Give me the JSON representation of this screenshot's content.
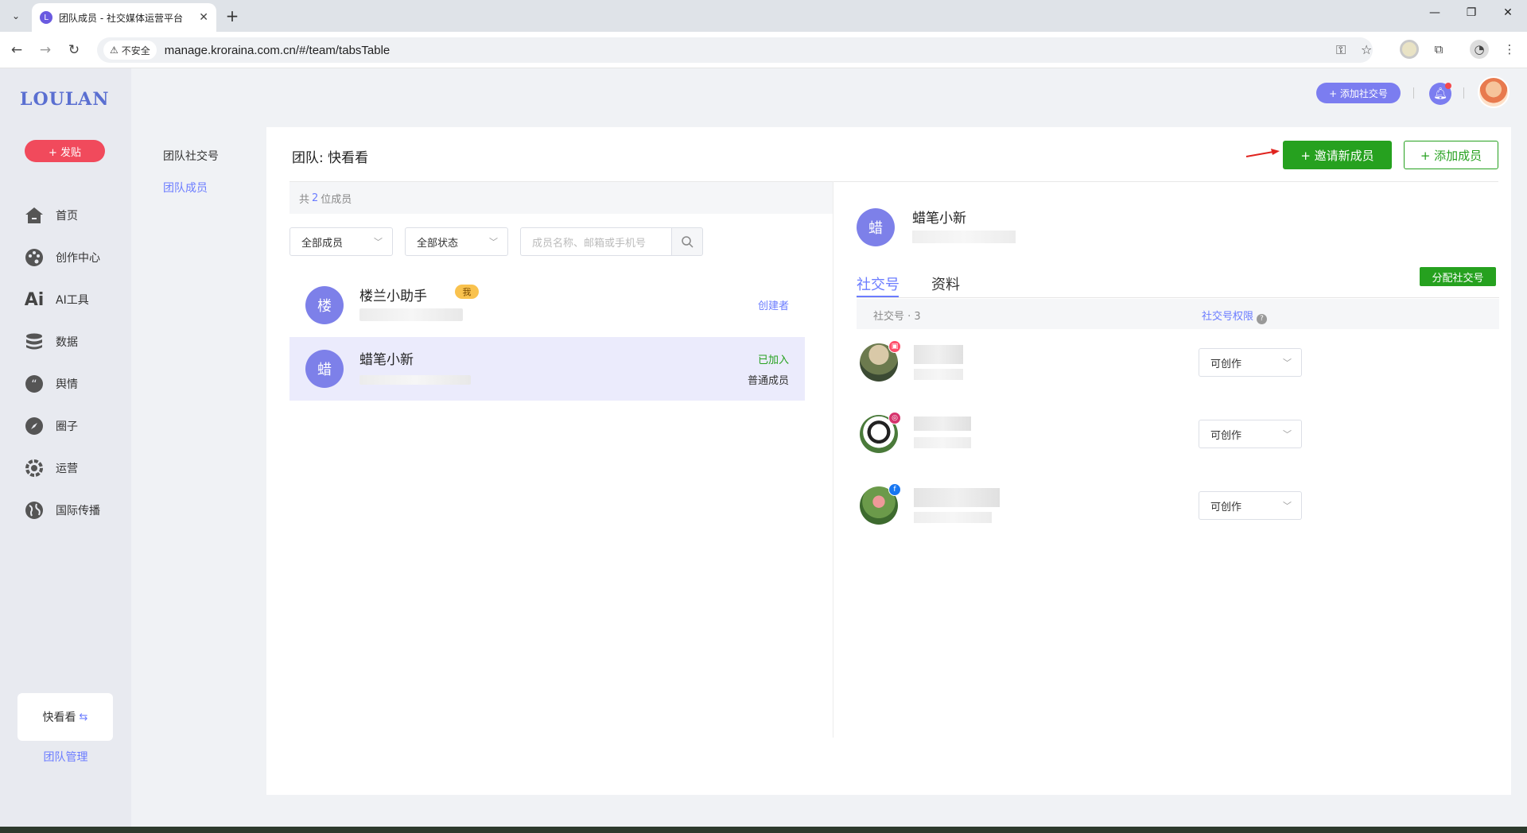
{
  "browser": {
    "tab_title": "团队成员 - 社交媒体运营平台",
    "security_label": "不安全",
    "url": "manage.kroraina.com.cn/#/team/tabsTable"
  },
  "sidebar": {
    "logo": "LOULAN",
    "post_button": "+ 发贴",
    "items": [
      {
        "label": "首页",
        "icon": "home-icon"
      },
      {
        "label": "创作中心",
        "icon": "palette-icon"
      },
      {
        "label": "AI工具",
        "icon": "ai-icon"
      },
      {
        "label": "数据",
        "icon": "database-icon"
      },
      {
        "label": "舆情",
        "icon": "quote-icon"
      },
      {
        "label": "圈子",
        "icon": "compass-icon"
      },
      {
        "label": "运营",
        "icon": "settings-icon"
      },
      {
        "label": "国际传播",
        "icon": "globe-icon"
      }
    ],
    "team_card": "快看看",
    "team_management": "团队管理"
  },
  "subnav": {
    "items": [
      "团队社交号",
      "团队成员"
    ],
    "active_index": 1
  },
  "header": {
    "add_social_button": "+ 添加社交号"
  },
  "panel": {
    "title": "团队: 快看看",
    "invite_button": "+ 邀请新成员",
    "add_member_button": "+ 添加成员",
    "count_prefix": "共",
    "count": "2",
    "count_suffix": "位成员",
    "filter_members": "全部成员",
    "filter_status": "全部状态",
    "search_placeholder": "成员名称、邮箱或手机号",
    "members": [
      {
        "avatar": "楼",
        "name": "楼兰小助手",
        "badge": "我",
        "role_top": "创建者",
        "role_bottom": ""
      },
      {
        "avatar": "蜡",
        "name": "蜡笔小新",
        "badge": "",
        "role_top": "已加入",
        "role_bottom": "普通成员"
      }
    ]
  },
  "detail": {
    "avatar": "蜡",
    "name": "蜡笔小新",
    "tabs": [
      "社交号",
      "资料"
    ],
    "active_tab": 0,
    "assign_button": "分配社交号",
    "col_account": "社交号 · 3",
    "col_permission": "社交号权限",
    "accounts": [
      {
        "platform": "xiaohongshu",
        "permission": "可创作"
      },
      {
        "platform": "instagram",
        "permission": "可创作"
      },
      {
        "platform": "facebook",
        "permission": "可创作"
      }
    ]
  },
  "colors": {
    "accent": "#6b7cff",
    "green": "#26a11f",
    "red": "#f14a5c",
    "avatar": "#7d80e9"
  }
}
